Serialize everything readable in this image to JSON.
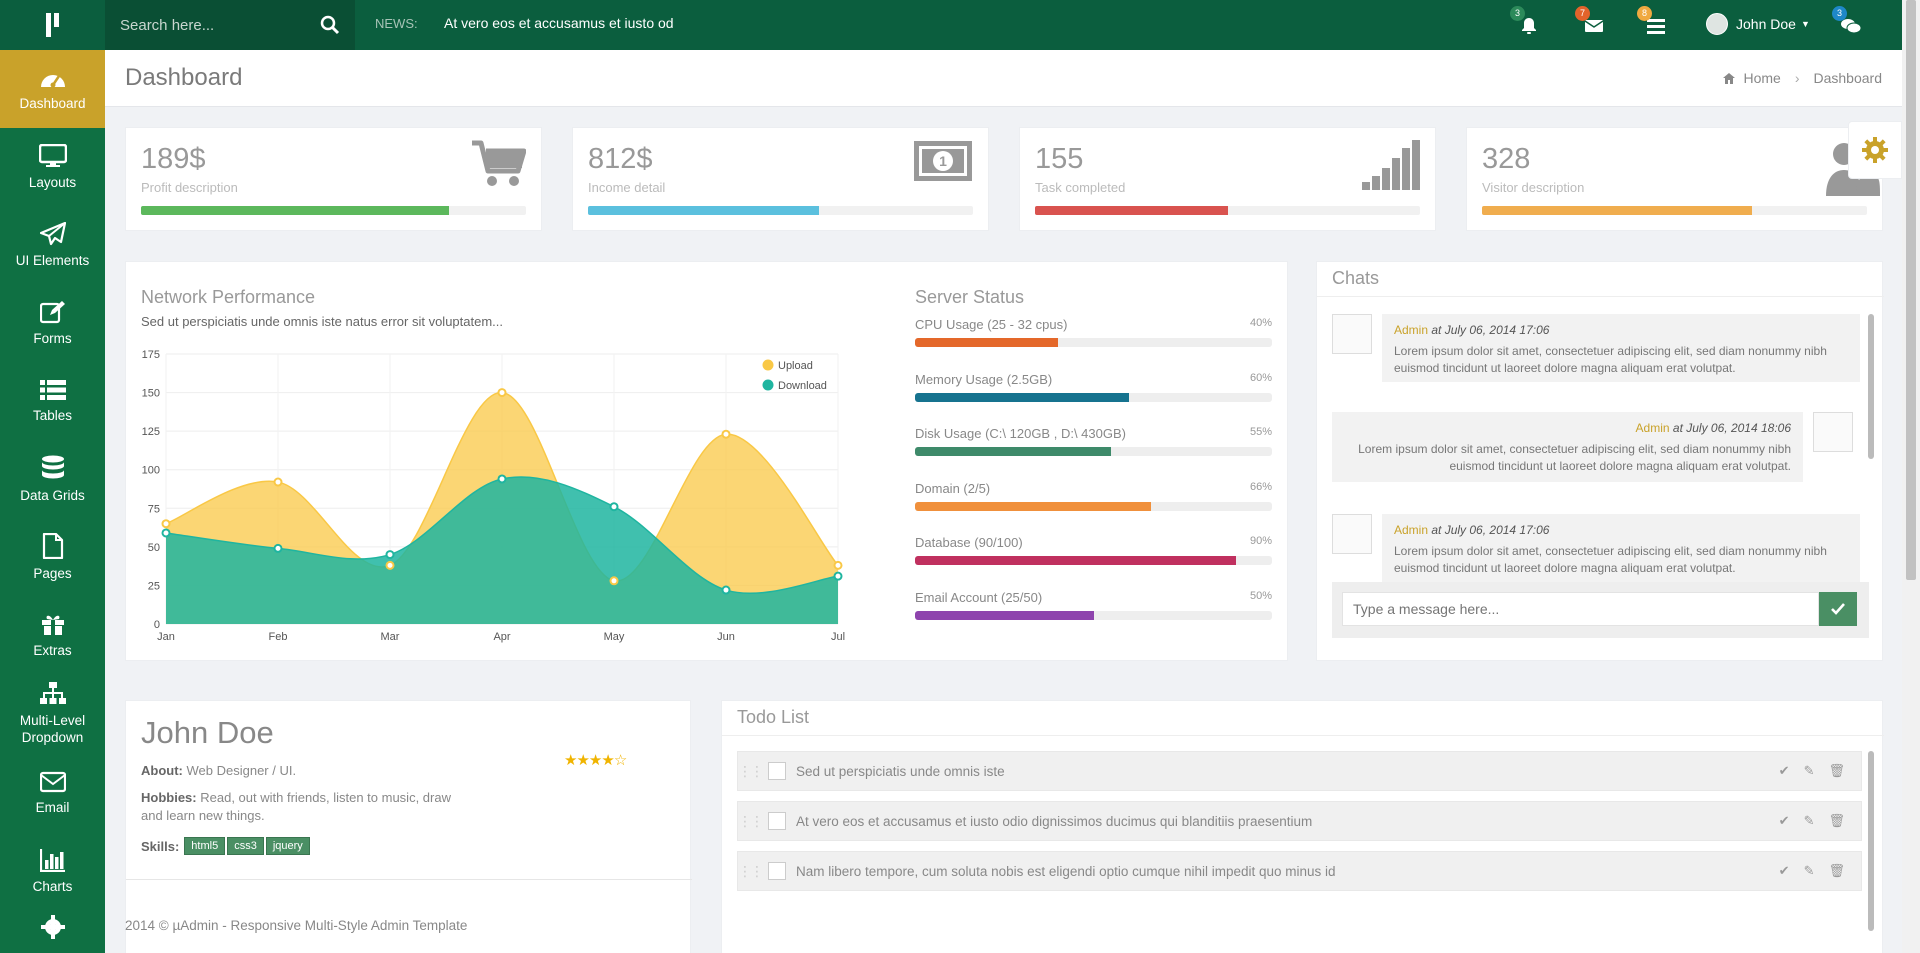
{
  "topbar": {
    "search_placeholder": "Search here...",
    "news_label": "NEWS:",
    "news_text": "At vero eos et accusamus et iusto od",
    "notifications": [
      {
        "icon": "bell-icon",
        "count": "3",
        "color": "#2c8a5a"
      },
      {
        "icon": "envelope-icon",
        "count": "7",
        "color": "#e2632b"
      },
      {
        "icon": "tasks-icon",
        "count": "8",
        "color": "#f0a940"
      }
    ],
    "user_name": "John Doe",
    "chat_count": "3"
  },
  "sidebar": {
    "items": [
      {
        "label": "Dashboard",
        "icon": "dashboard-icon",
        "active": true
      },
      {
        "label": "Layouts",
        "icon": "desktop-icon"
      },
      {
        "label": "UI Elements",
        "icon": "paper-plane-icon"
      },
      {
        "label": "Forms",
        "icon": "edit-icon"
      },
      {
        "label": "Tables",
        "icon": "list-icon"
      },
      {
        "label": "Data Grids",
        "icon": "database-icon"
      },
      {
        "label": "Pages",
        "icon": "file-icon"
      },
      {
        "label": "Extras",
        "icon": "gift-icon"
      },
      {
        "label": "Multi-Level Dropdown",
        "icon": "sitemap-icon"
      },
      {
        "label": "Email",
        "icon": "envelope-icon"
      },
      {
        "label": "Charts",
        "icon": "bar-chart-icon"
      }
    ]
  },
  "page": {
    "title": "Dashboard",
    "breadcrumb_home": "Home",
    "breadcrumb_current": "Dashboard"
  },
  "stats": [
    {
      "value": "189$",
      "desc": "Profit description",
      "progress": 0.8,
      "color": "#5cb85c",
      "icon": "cart-icon"
    },
    {
      "value": "812$",
      "desc": "Income detail",
      "progress": 0.6,
      "color": "#5bc0de",
      "icon": "money-icon"
    },
    {
      "value": "155",
      "desc": "Task completed",
      "progress": 0.5,
      "color": "#d9534f",
      "icon": "signal-icon"
    },
    {
      "value": "328",
      "desc": "Visitor description",
      "progress": 0.7,
      "color": "#f0ad4e",
      "icon": "users-icon"
    }
  ],
  "network": {
    "title": "Network Performance",
    "subtitle": "Sed ut perspiciatis unde omnis iste natus error sit voluptatem..."
  },
  "chart_data": {
    "type": "area",
    "x": [
      "Jan",
      "Feb",
      "Mar",
      "Apr",
      "May",
      "Jun",
      "Jul"
    ],
    "ylim": [
      0,
      175
    ],
    "yticks": [
      0,
      25,
      50,
      75,
      100,
      125,
      150,
      175
    ],
    "grid": true,
    "legend": "top-right",
    "series": [
      {
        "name": "Upload",
        "values": [
          65,
          92,
          38,
          150,
          28,
          123,
          38
        ],
        "color": "#f9c846"
      },
      {
        "name": "Download",
        "values": [
          59,
          49,
          45,
          94,
          76,
          22,
          31
        ],
        "color": "#1fb5a0"
      }
    ]
  },
  "server": {
    "title": "Server Status",
    "rows": [
      {
        "label": "CPU Usage (25 - 32 cpus)",
        "pct": "40%",
        "value": 0.4,
        "color": "#e4682a"
      },
      {
        "label": "Memory Usage (2.5GB)",
        "pct": "60%",
        "value": 0.6,
        "color": "#16738f"
      },
      {
        "label": "Disk Usage (C:\\ 120GB , D:\\ 430GB)",
        "pct": "55%",
        "value": 0.55,
        "color": "#3e8a6a"
      },
      {
        "label": "Domain (2/5)",
        "pct": "66%",
        "value": 0.66,
        "color": "#f0903c"
      },
      {
        "label": "Database (90/100)",
        "pct": "90%",
        "value": 0.9,
        "color": "#c0305f"
      },
      {
        "label": "Email Account (25/50)",
        "pct": "50%",
        "value": 0.5,
        "color": "#8e44ad"
      }
    ]
  },
  "chats": {
    "title": "Chats",
    "messages": [
      {
        "name": "Admin",
        "at": "at July 06, 2014 17:06",
        "text": "Lorem ipsum dolor sit amet, consectetuer adipiscing elit, sed diam nonummy nibh euismod tincidunt ut laoreet dolore magna aliquam erat volutpat."
      },
      {
        "name": "Admin",
        "at": "at July 06, 2014 18:06",
        "text": "Lorem ipsum dolor sit amet, consectetuer adipiscing elit, sed diam nonummy nibh euismod tincidunt ut laoreet dolore magna aliquam erat volutpat."
      },
      {
        "name": "Admin",
        "at": "at July 06, 2014 17:06",
        "text": "Lorem ipsum dolor sit amet, consectetuer adipiscing elit, sed diam nonummy nibh euismod tincidunt ut laoreet dolore magna aliquam erat volutpat."
      }
    ],
    "input_placeholder": "Type a message here..."
  },
  "profile": {
    "name": "John Doe",
    "about_label": "About:",
    "about": "Web Designer / UI.",
    "hobbies_label": "Hobbies:",
    "hobbies": "Read, out with friends, listen to music, draw and learn new things.",
    "skills_label": "Skills:",
    "skills": [
      "html5",
      "css3",
      "jquery"
    ],
    "rating": 4,
    "rating_max": 5
  },
  "todo": {
    "title": "Todo List",
    "items": [
      "Sed ut perspiciatis unde omnis iste",
      "At vero eos et accusamus et iusto odio dignissimos ducimus qui blanditiis praesentium",
      "Nam libero tempore, cum soluta nobis est eligendi optio cumque nihil impedit quo minus id"
    ]
  },
  "footer": {
    "text": "2014 © µAdmin - Responsive Multi-Style Admin Template"
  }
}
